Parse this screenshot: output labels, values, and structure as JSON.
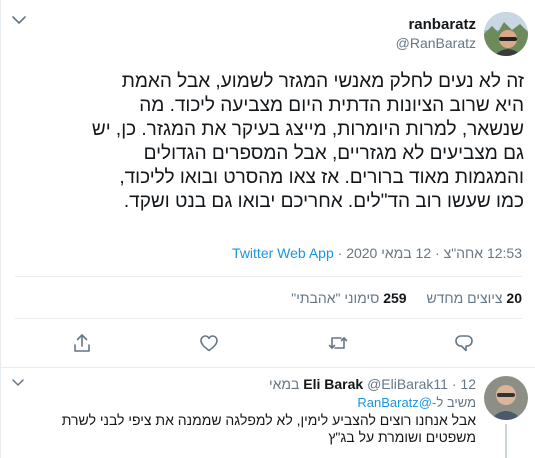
{
  "tweet": {
    "display_name": "ranbaratz",
    "handle": "@RanBaratz",
    "text": "זה לא נעים לחלק מאנשי המגזר לשמוע, אבל האמת\nהיא שרוב הציונות הדתית היום מצביעה ליכוד. מה\nשנשאר, למרות היומרות, מייצג בעיקר את המגזר. כן, יש\nגם מצביעים לא מגזריים, אבל המספרים הגדולים\nוהמגמות מאוד ברורים. אז צאו מהסרט ובואו לליכוד,\nכמו שעשו רוב הד\"לים. אחריכם יבואו גם בנט ושקד.",
    "time": "12:53 אחה\"צ",
    "date": "12 במאי 2020",
    "separator": "·",
    "source": "Twitter Web App"
  },
  "stats": {
    "retweets_count": "20",
    "retweets_label": "ציוצים מחדש",
    "likes_count": "259",
    "likes_label": "סימוני \"אהבתי\""
  },
  "actions": [
    "reply-icon",
    "retweet-icon",
    "like-icon",
    "share-icon"
  ],
  "reply": {
    "name": "Eli Barak",
    "handle": "@EliBarak11",
    "date": "12 במאי",
    "separator": "·",
    "reply_prefix": "משיב ל-",
    "reply_mention": "@RanBaratz",
    "text": "אבל אנחנו רוצים להצביע לימין, לא למפלגה שממנה את ציפי לבני לשרת\nמשפטים ושומרת על בג\"ץ"
  },
  "colors": {
    "text": "#14171a",
    "secondary": "#657786",
    "link": "#1b95e0",
    "divider": "#e6ecf0"
  }
}
